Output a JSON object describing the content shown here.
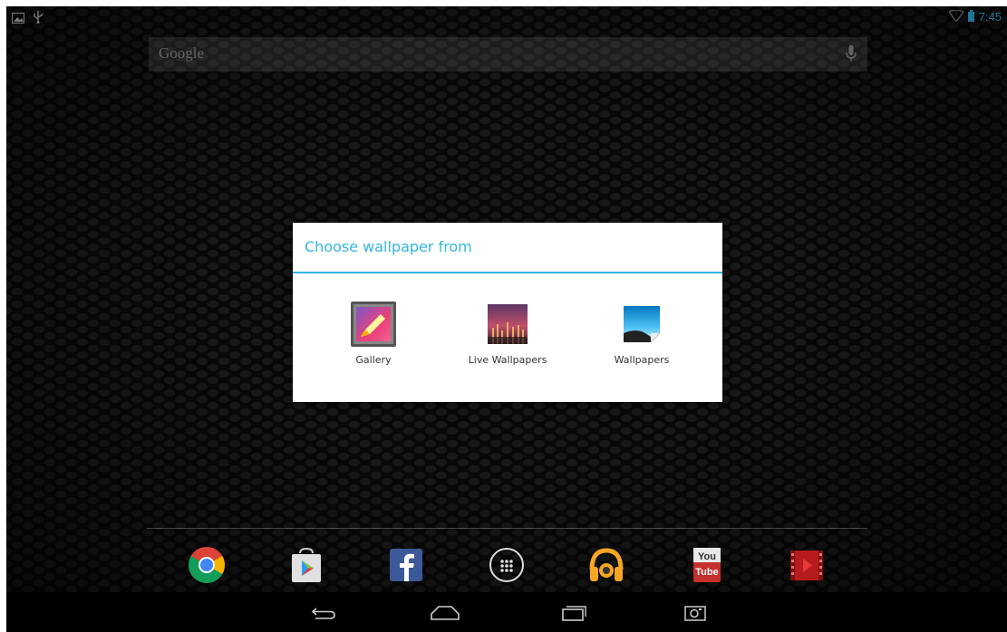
{
  "status_bar": {
    "time": "7:45",
    "icons": [
      "picture-notification-icon",
      "usb-icon",
      "wifi-icon",
      "battery-icon"
    ]
  },
  "search_bar": {
    "logo_text": "Google",
    "icon": "mic-icon"
  },
  "dialog": {
    "title": "Choose wallpaper from",
    "options": [
      {
        "label": "Gallery",
        "icon": "gallery-icon"
      },
      {
        "label": "Live Wallpapers",
        "icon": "live-wallpapers-icon"
      },
      {
        "label": "Wallpapers",
        "icon": "wallpapers-icon"
      }
    ]
  },
  "dock": {
    "items": [
      {
        "name": "chrome-icon"
      },
      {
        "name": "play-store-icon"
      },
      {
        "name": "facebook-icon"
      },
      {
        "name": "all-apps-icon"
      },
      {
        "name": "play-music-icon"
      },
      {
        "name": "youtube-icon",
        "text_top": "You",
        "text_bottom": "Tube"
      },
      {
        "name": "play-movies-icon"
      }
    ]
  },
  "nav_bar": {
    "buttons": [
      "back-icon",
      "home-icon",
      "recent-apps-icon",
      "screenshot-icon"
    ]
  },
  "colors": {
    "accent": "#33b5e5"
  }
}
